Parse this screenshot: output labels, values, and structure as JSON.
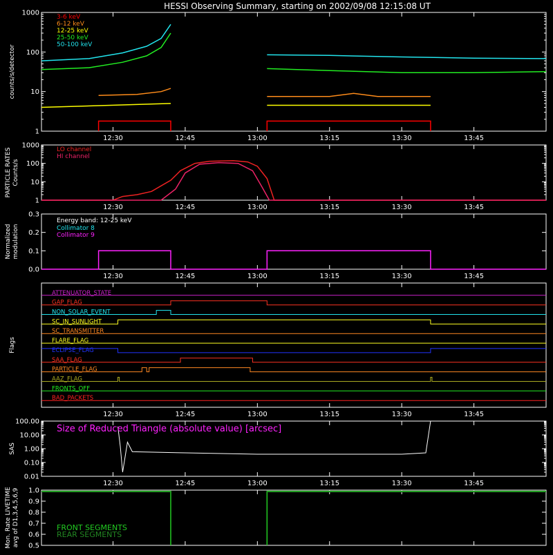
{
  "title": "HESSI Observing Summary, starting on 2002/09/08 12:15:08 UT",
  "time_ticks": [
    "12:30",
    "12:45",
    "13:00",
    "13:15",
    "13:30",
    "13:45"
  ],
  "time_tick_minutes": [
    30,
    45,
    60,
    75,
    90,
    105
  ],
  "x_range_minutes": [
    15.13,
    120
  ],
  "colors": {
    "band_3_6": "#ff0000",
    "band_6_12": "#ff8c1a",
    "band_12_25": "#ffff00",
    "band_25_50": "#22ee22",
    "band_50_100": "#22e5ee",
    "lo_channel": "#ee2222",
    "hi_channel": "#ee2266",
    "collimator_8": "#22e5ee",
    "collimator_9": "#ff22ff",
    "sas": "#ffffff",
    "front_segments": "#22cc22",
    "rear_segments": "#228822"
  },
  "chart_data": [
    {
      "id": "count-rates",
      "type": "line",
      "ylabel": "counts/s/detector",
      "ylim": [
        1,
        1000
      ],
      "yscale": "log",
      "yticks": [
        "1",
        "10",
        "100",
        "1000"
      ],
      "legend_placement": "top-left",
      "legend": [
        "3-6 keV",
        "6-12 keV",
        "12-25 keV",
        "25-50 keV",
        "50-100 keV"
      ],
      "series": [
        {
          "name": "3-6 keV",
          "segments": [
            [
              [
                27,
                1
              ],
              [
                27,
                1.8
              ],
              [
                42,
                1.8
              ],
              [
                42,
                1
              ]
            ],
            [
              [
                62,
                1
              ],
              [
                62,
                1.8
              ],
              [
                96,
                1.8
              ],
              [
                96,
                1
              ]
            ]
          ]
        },
        {
          "name": "6-12 keV",
          "segments": [
            [
              [
                27,
                8
              ],
              [
                35,
                8.5
              ],
              [
                40,
                10
              ],
              [
                42,
                12
              ]
            ],
            [
              [
                62,
                7.5
              ],
              [
                75,
                7.5
              ],
              [
                80,
                9
              ],
              [
                85,
                7.5
              ],
              [
                96,
                7.5
              ]
            ]
          ]
        },
        {
          "name": "12-25 keV",
          "segments": [
            [
              [
                15.13,
                4
              ],
              [
                42,
                5
              ]
            ],
            [
              [
                62,
                4.5
              ],
              [
                96,
                4.5
              ]
            ]
          ]
        },
        {
          "name": "25-50 keV",
          "segments": [
            [
              [
                15.13,
                36
              ],
              [
                25,
                40
              ],
              [
                32,
                55
              ],
              [
                37,
                80
              ],
              [
                40,
                130
              ],
              [
                42,
                300
              ]
            ],
            [
              [
                62,
                38
              ],
              [
                75,
                34
              ],
              [
                90,
                30
              ],
              [
                105,
                30
              ],
              [
                120,
                32
              ]
            ]
          ]
        },
        {
          "name": "50-100 keV",
          "segments": [
            [
              [
                15.13,
                60
              ],
              [
                25,
                68
              ],
              [
                32,
                95
              ],
              [
                37,
                140
              ],
              [
                40,
                220
              ],
              [
                42,
                500
              ]
            ],
            [
              [
                62,
                85
              ],
              [
                75,
                82
              ],
              [
                90,
                75
              ],
              [
                105,
                70
              ],
              [
                120,
                68
              ]
            ]
          ]
        }
      ]
    },
    {
      "id": "particle-rates",
      "type": "line",
      "ylabel": "PARTICLE RATES Counts/s",
      "ylim": [
        1,
        1000
      ],
      "yscale": "log",
      "yticks": [
        "1",
        "10",
        "100",
        "1000"
      ],
      "legend_placement": "top-left",
      "legend": [
        "LO channel",
        "HI channel"
      ],
      "series": [
        {
          "name": "LO channel",
          "points": [
            [
              15.13,
              1
            ],
            [
              30,
              1
            ],
            [
              32,
              1.6
            ],
            [
              35,
              2
            ],
            [
              38,
              3
            ],
            [
              40,
              6
            ],
            [
              42,
              12
            ],
            [
              44,
              40
            ],
            [
              47,
              100
            ],
            [
              50,
              130
            ],
            [
              55,
              140
            ],
            [
              58,
              120
            ],
            [
              60,
              70
            ],
            [
              62,
              15
            ],
            [
              63.5,
              1
            ],
            [
              120,
              1
            ]
          ]
        },
        {
          "name": "HI channel",
          "points": [
            [
              15.13,
              1
            ],
            [
              40,
              1
            ],
            [
              43,
              4
            ],
            [
              45,
              30
            ],
            [
              48,
              90
            ],
            [
              52,
              110
            ],
            [
              56,
              100
            ],
            [
              59,
              40
            ],
            [
              61,
              5
            ],
            [
              62.5,
              1
            ],
            [
              120,
              1
            ]
          ]
        }
      ]
    },
    {
      "id": "modulation",
      "type": "line",
      "ylabel": "Normalized modulation",
      "ylim": [
        0,
        0.3
      ],
      "yticks": [
        "0.0",
        "0.1",
        "0.2",
        "0.3"
      ],
      "annotation": "Energy band: 12-25 keV",
      "legend_placement": "top-left",
      "legend": [
        "Collimator 8",
        "Collimator 9"
      ],
      "series": [
        {
          "name": "Collimator 8",
          "segments": [
            [
              [
                27,
                0.1
              ],
              [
                42,
                0.1
              ]
            ],
            [
              [
                62,
                0.1
              ],
              [
                96,
                0.1
              ]
            ]
          ]
        },
        {
          "name": "Collimator 9",
          "segments": [
            [
              [
                15.13,
                0
              ],
              [
                27,
                0
              ],
              [
                27,
                0.1
              ],
              [
                42,
                0.1
              ],
              [
                42,
                0
              ],
              [
                62,
                0
              ],
              [
                62,
                0.1
              ],
              [
                96,
                0.1
              ],
              [
                96,
                0
              ],
              [
                120,
                0
              ]
            ]
          ]
        }
      ]
    },
    {
      "id": "flags",
      "type": "line",
      "ylabel": "Flags",
      "flags": [
        {
          "name": "ATTENUATOR_STATE",
          "color": "#cc22cc",
          "transitions": []
        },
        {
          "name": "GAP_FLAG",
          "color": "#ff3322",
          "transitions": [
            [
              42,
              62
            ]
          ]
        },
        {
          "name": "NON_SOLAR_EVENT",
          "color": "#22e5ee",
          "transitions": [
            [
              39,
              42
            ]
          ]
        },
        {
          "name": "SC_IN_SUNLIGHT",
          "color": "#ffff22",
          "transitions": [
            [
              31,
              96
            ]
          ]
        },
        {
          "name": "SC_TRANSMITTER",
          "color": "#ff8822",
          "transitions": []
        },
        {
          "name": "FLARE_FLAG",
          "color": "#ffff22",
          "transitions": []
        },
        {
          "name": "ECLIPSE_FLAG",
          "color": "#2233ff",
          "high_base": true,
          "transitions": [
            [
              31,
              96
            ]
          ]
        },
        {
          "name": "SAA_FLAG",
          "color": "#ff3322",
          "transitions": [
            [
              44,
              59
            ]
          ]
        },
        {
          "name": "PARTICLE_FLAG",
          "color": "#ff8822",
          "transitions": [
            [
              36,
              37
            ],
            [
              37.5,
              58.5
            ]
          ]
        },
        {
          "name": "AAZ_FLAG",
          "color": "#aaaa22",
          "transitions": [
            [
              31,
              31.3
            ],
            [
              96,
              96.3
            ]
          ]
        },
        {
          "name": "FRONTS_OFF",
          "color": "#22ee22",
          "transitions": []
        },
        {
          "name": "BAD_PACKETS",
          "color": "#ff2222",
          "transitions": []
        }
      ]
    },
    {
      "id": "sas",
      "type": "line",
      "ylabel": "SAS",
      "ylim": [
        0.01,
        100
      ],
      "yscale": "log",
      "yticks": [
        "0.01",
        "0.10",
        "1.00",
        "10.00",
        "100.00"
      ],
      "legend_placement": "top-left",
      "legend": [
        "Size of Reduced Triangle (absolute value) [arcsec]"
      ],
      "series": [
        {
          "name": "Size of Reduced Triangle (absolute value) [arcsec]",
          "points": [
            [
              31,
              40
            ],
            [
              31.5,
              1.5
            ],
            [
              32,
              0.02
            ],
            [
              33,
              3
            ],
            [
              34,
              0.6
            ],
            [
              45,
              0.5
            ],
            [
              60,
              0.4
            ],
            [
              75,
              0.4
            ],
            [
              90,
              0.4
            ],
            [
              95,
              0.5
            ],
            [
              96,
              100
            ]
          ]
        }
      ]
    },
    {
      "id": "livetime",
      "type": "line",
      "ylabel": "Mon. Rate LIVETIME avg of D1,3,4,5,6,9",
      "ylim": [
        0.5,
        1.0
      ],
      "yticks": [
        "0.5",
        "0.6",
        "0.7",
        "0.8",
        "0.9",
        "1.0"
      ],
      "legend_placement": "bottom-left",
      "legend": [
        "FRONT SEGMENTS",
        "REAR SEGMENTS"
      ],
      "series": [
        {
          "name": "FRONT SEGMENTS",
          "segments": [
            [
              [
                15.13,
                0.99
              ],
              [
                42,
                0.99
              ],
              [
                42,
                0.5
              ]
            ],
            [
              [
                62,
                0.5
              ],
              [
                62,
                0.99
              ],
              [
                120,
                0.99
              ]
            ]
          ]
        },
        {
          "name": "REAR SEGMENTS",
          "segments": [
            [
              [
                15.13,
                0.985
              ],
              [
                42,
                0.985
              ]
            ],
            [
              [
                62,
                0.985
              ],
              [
                120,
                0.985
              ]
            ]
          ]
        }
      ]
    }
  ]
}
